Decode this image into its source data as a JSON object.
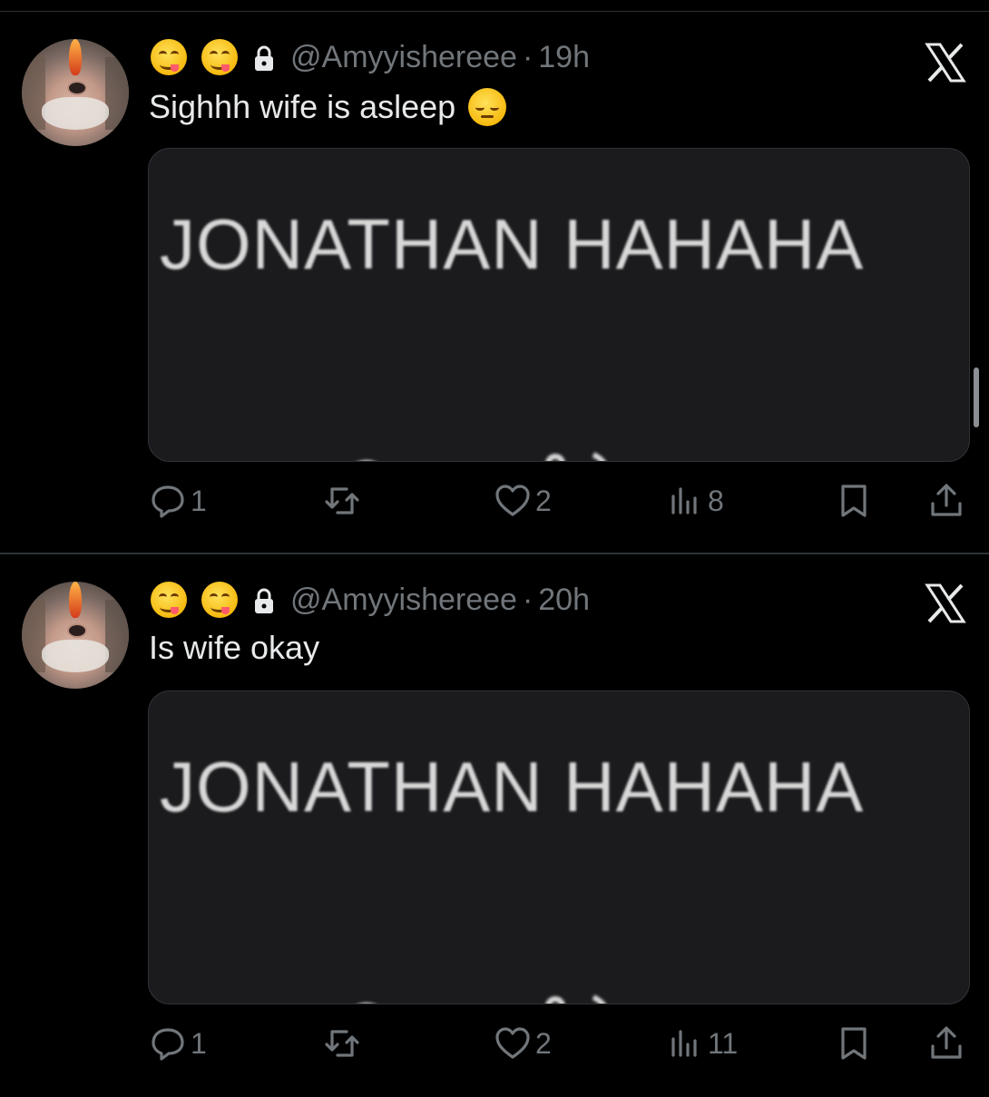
{
  "tweets": [
    {
      "handle": "@Amyyishereee",
      "time": "19h",
      "text": "Sighhh wife is asleep",
      "media_text": "JONATHAN HAHAHA",
      "stats": {
        "replies": "1",
        "likes": "2",
        "views": "8"
      }
    },
    {
      "handle": "@Amyyishereee",
      "time": "20h",
      "text": "Is wife okay",
      "media_text": "JONATHAN HAHAHA",
      "stats": {
        "replies": "1",
        "likes": "2",
        "views": "11"
      }
    }
  ],
  "separator": "·",
  "icons": {
    "name_emojis": [
      "yum-emoji-icon",
      "yum-emoji-icon"
    ],
    "lock": "lock-icon",
    "logo": "x-logo-icon",
    "reply": "reply-icon",
    "retweet": "retweet-icon",
    "like": "heart-icon",
    "views": "views-icon",
    "bookmark": "bookmark-icon",
    "share": "share-icon",
    "text_emoji_t1": "pensive-emoji-icon"
  },
  "colors": {
    "background": "#000000",
    "text_primary": "#e7e9ea",
    "text_secondary": "#71767b",
    "divider": "#2f3336"
  }
}
